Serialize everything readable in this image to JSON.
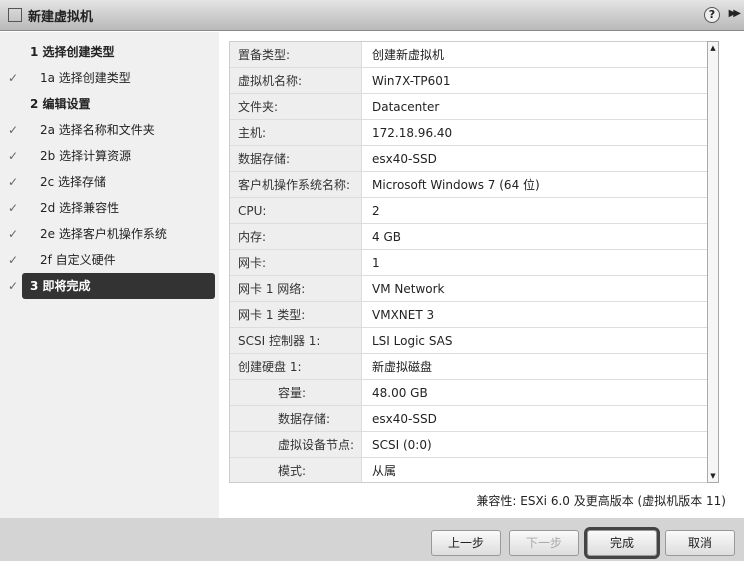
{
  "window": {
    "title": "新建虚拟机",
    "help": "?",
    "expand": "▶▶"
  },
  "steps": [
    {
      "label": "1 选择创建类型",
      "type": "head",
      "check": false
    },
    {
      "label": "1a 选择创建类型",
      "type": "sub",
      "check": true
    },
    {
      "label": "2 编辑设置",
      "type": "head",
      "check": false
    },
    {
      "label": "2a 选择名称和文件夹",
      "type": "sub",
      "check": true
    },
    {
      "label": "2b 选择计算资源",
      "type": "sub",
      "check": true
    },
    {
      "label": "2c 选择存储",
      "type": "sub",
      "check": true
    },
    {
      "label": "2d 选择兼容性",
      "type": "sub",
      "check": true
    },
    {
      "label": "2e 选择客户机操作系统",
      "type": "sub",
      "check": true
    },
    {
      "label": "2f 自定义硬件",
      "type": "sub",
      "check": true
    },
    {
      "label": "3 即将完成",
      "type": "head active",
      "check": true
    }
  ],
  "summary": [
    {
      "k": "置备类型:",
      "v": "创建新虚拟机"
    },
    {
      "k": "虚拟机名称:",
      "v": "Win7X-TP601"
    },
    {
      "k": "文件夹:",
      "v": "Datacenter"
    },
    {
      "k": "主机:",
      "v": "172.18.96.40"
    },
    {
      "k": "数据存储:",
      "v": "esx40-SSD"
    },
    {
      "k": "客户机操作系统名称:",
      "v": "Microsoft Windows 7 (64 位)"
    },
    {
      "k": "CPU:",
      "v": "2"
    },
    {
      "k": "内存:",
      "v": "4 GB"
    },
    {
      "k": "网卡:",
      "v": "1"
    },
    {
      "k": "网卡 1 网络:",
      "v": "VM Network"
    },
    {
      "k": "网卡 1 类型:",
      "v": "VMXNET 3"
    },
    {
      "k": "SCSI 控制器 1:",
      "v": "LSI Logic SAS"
    },
    {
      "k": "创建硬盘 1:",
      "v": "新虚拟磁盘"
    },
    {
      "k": "容量:",
      "v": "48.00 GB",
      "indent": true
    },
    {
      "k": "数据存储:",
      "v": "esx40-SSD",
      "indent": true
    },
    {
      "k": "虚拟设备节点:",
      "v": "SCSI (0:0)",
      "indent": true
    },
    {
      "k": "模式:",
      "v": "从属",
      "indent": true
    }
  ],
  "compat": "兼容性: ESXi 6.0 及更高版本 (虚拟机版本 11)",
  "buttons": {
    "back": "上一步",
    "next": "下一步",
    "finish": "完成",
    "cancel": "取消"
  }
}
